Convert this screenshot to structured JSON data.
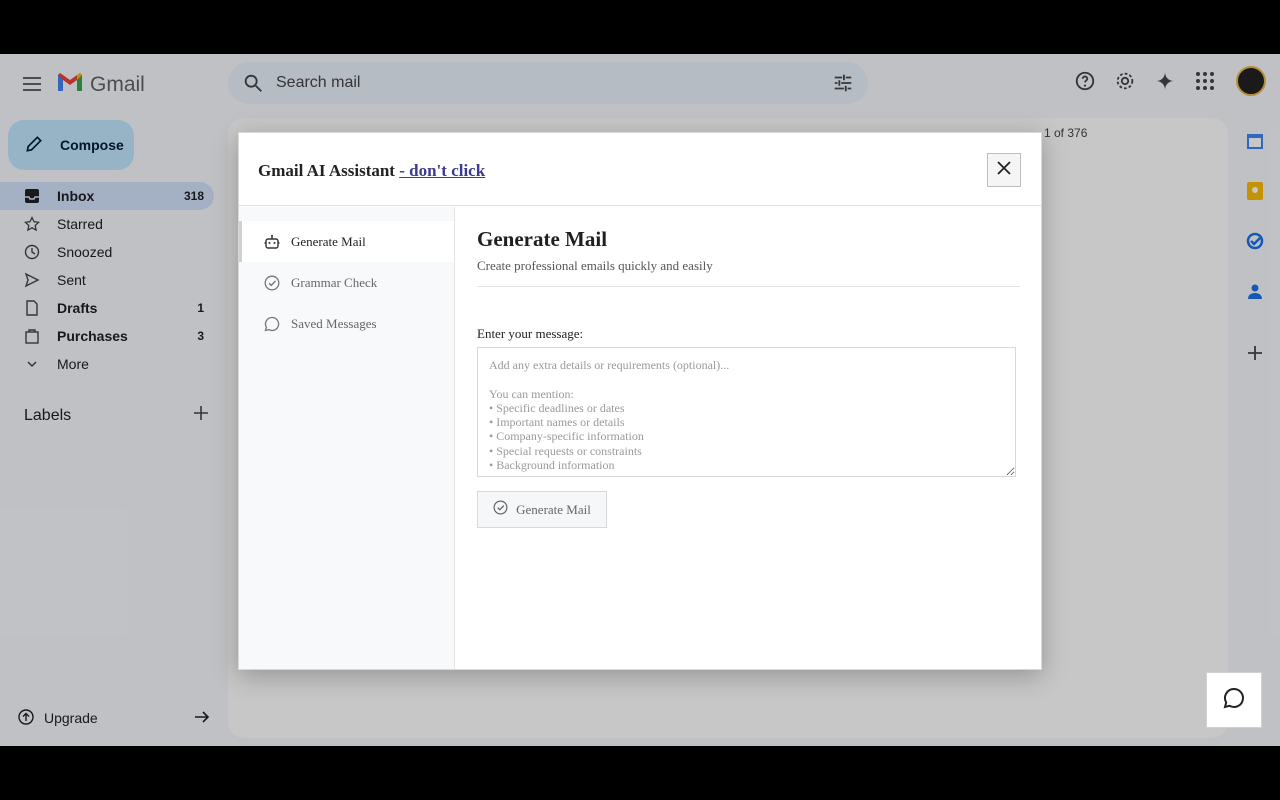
{
  "app": {
    "name": "Gmail"
  },
  "search": {
    "placeholder": "Search mail"
  },
  "compose": {
    "label": "Compose"
  },
  "nav": [
    {
      "label": "Inbox",
      "count": "318",
      "icon": "inbox-icon"
    },
    {
      "label": "Starred",
      "count": "",
      "icon": "star-icon"
    },
    {
      "label": "Snoozed",
      "count": "",
      "icon": "clock-icon"
    },
    {
      "label": "Sent",
      "count": "",
      "icon": "send-icon"
    },
    {
      "label": "Drafts",
      "count": "1",
      "icon": "draft-icon"
    },
    {
      "label": "Purchases",
      "count": "3",
      "icon": "bag-icon"
    },
    {
      "label": "More",
      "count": "",
      "icon": "chevron-down-icon"
    }
  ],
  "labels": {
    "title": "Labels"
  },
  "upgrade": {
    "label": "Upgrade"
  },
  "pager": {
    "text": "1 of 376"
  },
  "modal": {
    "title": "Gmail AI Assistant ",
    "title_link": "- don't click",
    "tabs": [
      {
        "label": "Generate Mail",
        "icon": "robot-icon",
        "active": true
      },
      {
        "label": "Grammar Check",
        "icon": "check-circle-icon",
        "active": false
      },
      {
        "label": "Saved Messages",
        "icon": "chat-bubble-icon",
        "active": false
      }
    ],
    "content": {
      "title": "Generate Mail",
      "subtitle": "Create professional emails quickly and easily",
      "field_label": "Enter your message:",
      "placeholder": "Add any extra details or requirements (optional)...\n\nYou can mention:\n• Specific deadlines or dates\n• Important names or details\n• Company-specific information\n• Special requests or constraints\n• Background information",
      "button_label": "Generate Mail"
    }
  },
  "colors": {
    "gmail_bg": "#f6f8fc",
    "compose_bg": "#c2e7ff",
    "nav_active": "#d3e3fd",
    "link": "#3b3b8f"
  }
}
